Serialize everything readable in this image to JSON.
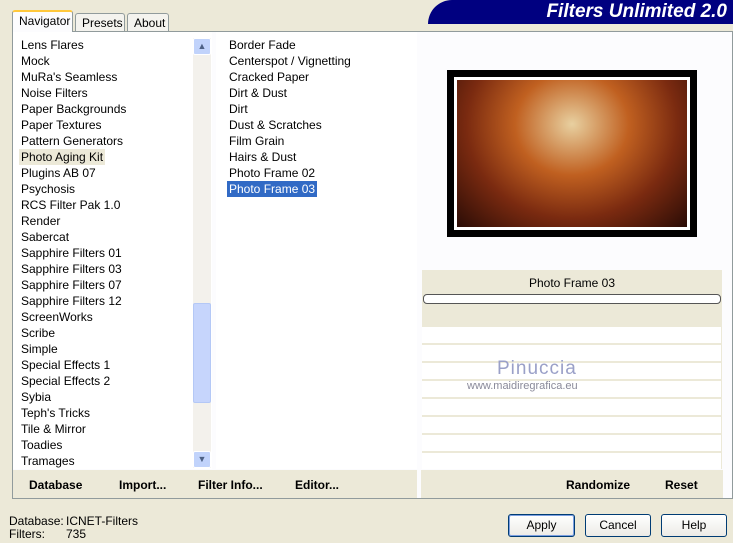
{
  "app": {
    "title": "Filters Unlimited 2.0"
  },
  "tabs": [
    {
      "label": "Navigator",
      "active": true
    },
    {
      "label": "Presets"
    },
    {
      "label": "About"
    }
  ],
  "categories": {
    "items": [
      "Lens Flares",
      "Mock",
      "MuRa's Seamless",
      "Noise Filters",
      "Paper Backgrounds",
      "Paper Textures",
      "Pattern Generators",
      "Photo Aging Kit",
      "Plugins AB 07",
      "Psychosis",
      "RCS Filter Pak 1.0",
      "Render",
      "Sabercat",
      "Sapphire Filters 01",
      "Sapphire Filters 03",
      "Sapphire Filters 07",
      "Sapphire Filters 12",
      "ScreenWorks",
      "Scribe",
      "Simple",
      "Special Effects 1",
      "Special Effects 2",
      "Sybia",
      "Teph's Tricks",
      "Tile & Mirror",
      "Toadies",
      "Tramages"
    ],
    "selected": "Photo Aging Kit"
  },
  "filters": {
    "items": [
      "Border Fade",
      "Centerspot / Vignetting",
      "Cracked Paper",
      "Dirt & Dust",
      "Dirt",
      "Dust & Scratches",
      "Film Grain",
      "Hairs & Dust",
      "Photo Frame 02",
      "Photo Frame 03"
    ],
    "selected": "Photo Frame 03"
  },
  "preview": {
    "filter_name": "Photo Frame 03"
  },
  "watermark": {
    "name": "Pinuccia",
    "url": "www.maidiregrafica.eu"
  },
  "toolbar": {
    "database": "Database",
    "import": "Import...",
    "filter_info": "Filter Info...",
    "editor": "Editor...",
    "randomize": "Randomize",
    "reset": "Reset"
  },
  "status": {
    "database_label": "Database:",
    "database_value": "ICNET-Filters",
    "filters_label": "Filters:",
    "filters_value": "735"
  },
  "buttons": {
    "apply": "Apply",
    "cancel": "Cancel",
    "help": "Help"
  }
}
